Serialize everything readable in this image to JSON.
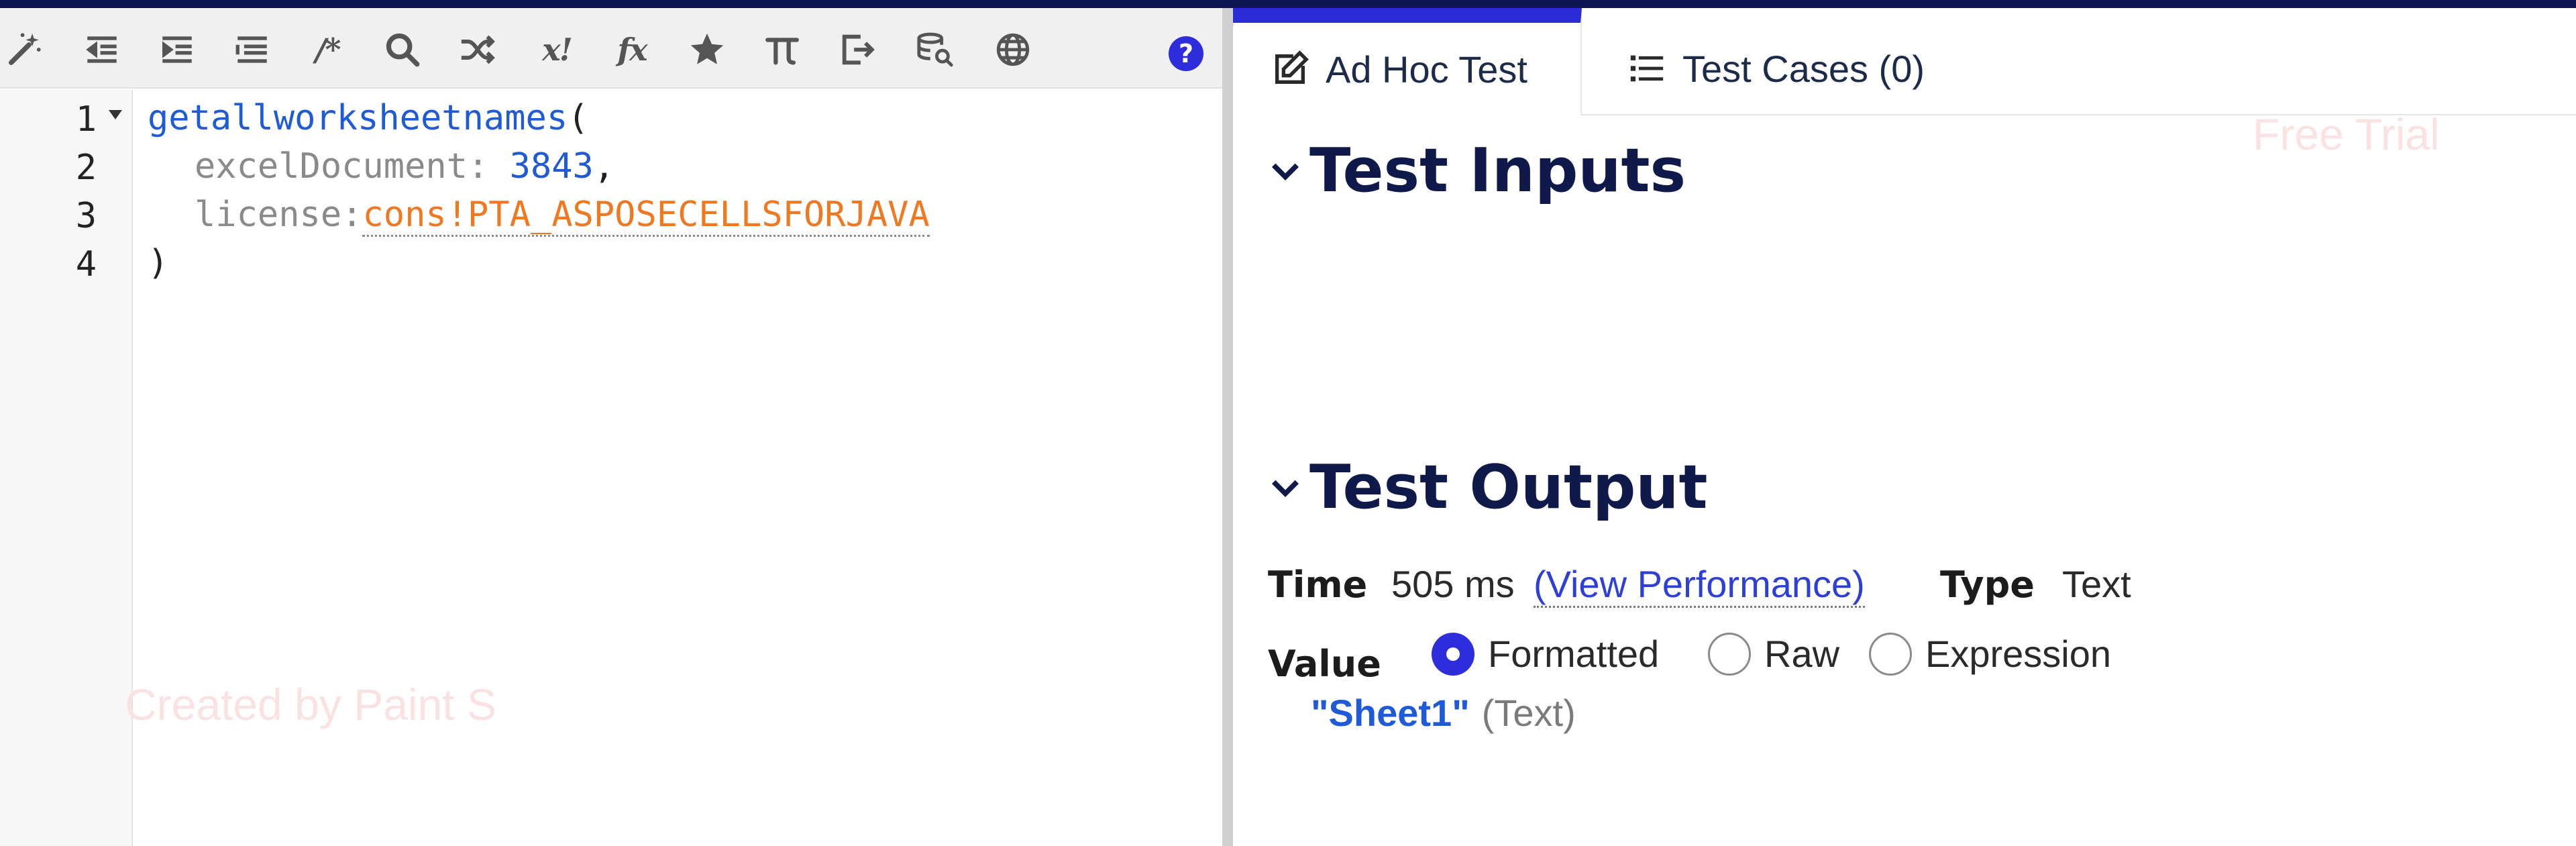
{
  "editor": {
    "toolbar": {
      "icons": [
        "magic-wand-icon",
        "outdent-icon",
        "indent-icon",
        "list-icon",
        "comment-icon",
        "search-icon",
        "shuffle-icon",
        "exclamation-icon",
        "function-icon",
        "star-icon",
        "pi-icon",
        "export-icon",
        "database-search-icon",
        "globe-icon",
        "help-icon"
      ],
      "comment_label": "/*",
      "x_label": "x!",
      "fx_label": "fx",
      "help_label": "?"
    },
    "line_numbers": [
      "1",
      "2",
      "3",
      "4"
    ],
    "code": {
      "function_name": "getallworksheetnames",
      "open_paren": "(",
      "arg1_key": "excelDocument",
      "arg1_sep": ": ",
      "arg1_value": "3843",
      "arg1_comma": ",",
      "arg2_key": "license",
      "arg2_sep": ":",
      "arg2_value": "cons!PTA_ASPOSECELLSFORJAVA",
      "close_paren": ")"
    },
    "watermark": "Created by Paint S"
  },
  "test_panel": {
    "tabs": [
      {
        "label": "Ad Hoc Test",
        "icon": "edit-icon",
        "active": true
      },
      {
        "label": "Test Cases (0)",
        "icon": "list-icon",
        "active": false
      }
    ],
    "watermark": "Free Trial",
    "inputs_title": "Test Inputs",
    "output_title": "Test Output",
    "time_label": "Time",
    "time_value": "505 ms",
    "view_performance": "(View Performance)",
    "type_label": "Type",
    "type_value": "Text",
    "value_label": "Value",
    "value_modes": [
      "Formatted",
      "Raw",
      "Expression"
    ],
    "selected_mode": "Formatted",
    "result_value": "\"Sheet1\"",
    "result_type": "(Text)"
  },
  "colors": {
    "accent": "#2d2ddb",
    "topbar": "#0f1551",
    "function_blue": "#1f5bd6",
    "constant_orange": "#f07820",
    "heading_navy": "#101a4a"
  }
}
